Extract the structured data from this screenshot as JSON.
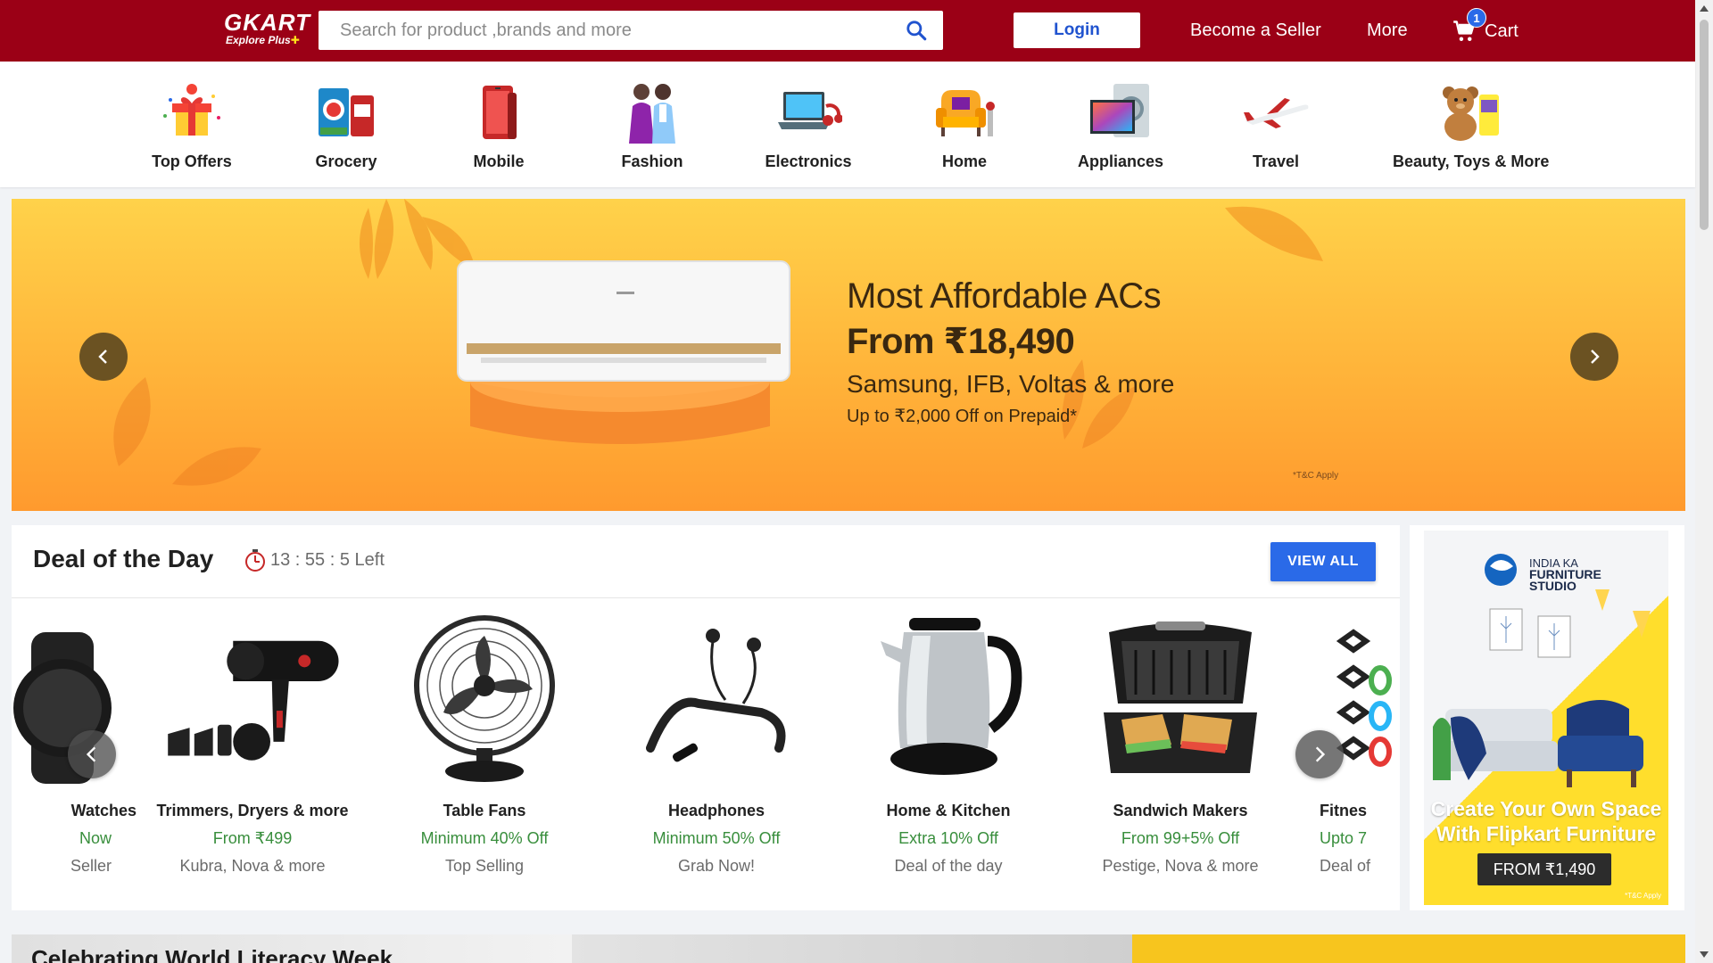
{
  "header": {
    "logo_text": "GKART",
    "logo_sub": "Explore Plus",
    "search_placeholder": "Search for product ,brands and more",
    "login_label": "Login",
    "seller_label": "Become a Seller",
    "more_label": "More",
    "cart_label": "Cart",
    "cart_count": "1",
    "brand_color": "#9b0016"
  },
  "categories": [
    {
      "label": "Top Offers",
      "icon": "gift-offers-icon"
    },
    {
      "label": "Grocery",
      "icon": "grocery-icon"
    },
    {
      "label": "Mobile",
      "icon": "mobile-icon"
    },
    {
      "label": "Fashion",
      "icon": "fashion-icon"
    },
    {
      "label": "Electronics",
      "icon": "laptop-icon"
    },
    {
      "label": "Home",
      "icon": "armchair-icon"
    },
    {
      "label": "Appliances",
      "icon": "appliances-icon"
    },
    {
      "label": "Travel",
      "icon": "airplane-icon"
    },
    {
      "label": "Beauty, Toys & More",
      "icon": "teddy-bear-icon"
    }
  ],
  "banner": {
    "line1": "Most Affordable ACs",
    "line2": "From ₹18,490",
    "line3": "Samsung, IFB, Voltas & more",
    "line4": "Up to ₹2,000 Off on Prepaid*",
    "tc": "*T&C Apply"
  },
  "deal": {
    "title": "Deal of the Day",
    "timer": "13 : 55 : 5 Left",
    "view_all": "VIEW ALL",
    "items": [
      {
        "name": "Watches",
        "offer": "Now",
        "sub": "Seller",
        "icon": "watch-icon"
      },
      {
        "name": "Trimmers, Dryers & more",
        "offer": "From ₹499",
        "sub": "Kubra, Nova & more",
        "icon": "hair-dryer-icon"
      },
      {
        "name": "Table Fans",
        "offer": "Minimum 40% Off",
        "sub": "Top Selling",
        "icon": "table-fan-icon"
      },
      {
        "name": "Headphones",
        "offer": "Minimum 50% Off",
        "sub": "Grab Now!",
        "icon": "neckband-headphones-icon"
      },
      {
        "name": "Home & Kitchen",
        "offer": "Extra 10% Off",
        "sub": "Deal of the day",
        "icon": "kettle-icon"
      },
      {
        "name": "Sandwich Makers",
        "offer": "From 99+5% Off",
        "sub": "Pestige, Nova & more",
        "icon": "sandwich-maker-icon"
      },
      {
        "name": "Fitnes",
        "offer": "Upto 7",
        "sub": "Deal of",
        "icon": "resistance-bands-icon"
      }
    ]
  },
  "side_ad": {
    "brand_small": "INDIA KA",
    "brand_line1": "FURNITURE",
    "brand_line2": "STUDIO",
    "headline": "Create Your Own Space With Flipkart Furniture",
    "cta": "FROM ₹1,490",
    "tc": "*T&C Apply"
  },
  "bottom": {
    "strip1_title": "Celebrating World Literacy Week"
  }
}
